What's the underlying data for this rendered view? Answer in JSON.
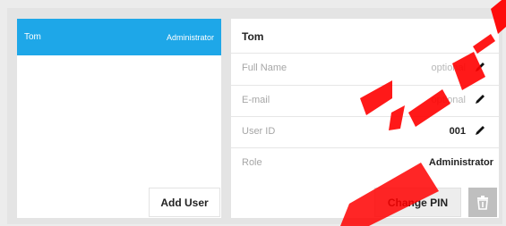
{
  "users_list": {
    "selected_user": {
      "name": "Tom",
      "role": "Administrator"
    },
    "add_user_label": "Add User"
  },
  "user_details": {
    "header_name": "Tom",
    "fields": [
      {
        "label": "Full Name",
        "value": "optional",
        "editable": true
      },
      {
        "label": "E-mail",
        "value": "optional",
        "editable": true
      },
      {
        "label": "User ID",
        "value": "001",
        "editable": true
      },
      {
        "label": "Role",
        "value": "Administrator",
        "editable": false
      }
    ],
    "change_pin_label": "Change PIN",
    "delete_icon": "trash-icon"
  },
  "colors": {
    "accent": "#1ea7e8",
    "watermark": "#ff0000"
  },
  "icons": {
    "edit": "pencil-icon",
    "delete": "trash-icon"
  }
}
